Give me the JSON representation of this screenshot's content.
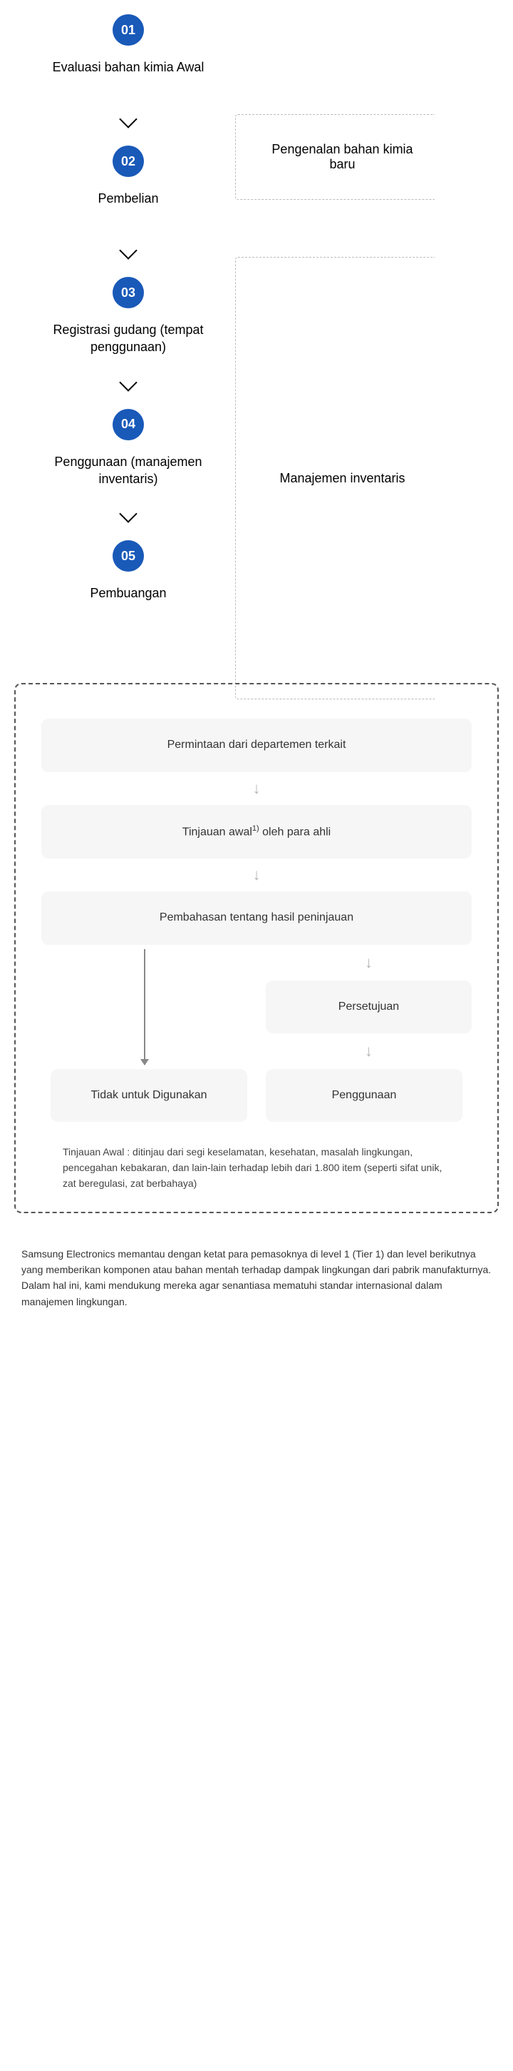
{
  "steps": [
    {
      "num": "01",
      "title": "Evaluasi bahan kimia Awal"
    },
    {
      "num": "02",
      "title": "Pembelian"
    },
    {
      "num": "03",
      "title": "Registrasi gudang (tempat penggunaan)"
    },
    {
      "num": "04",
      "title": "Penggunaan (manajemen inventaris)"
    },
    {
      "num": "05",
      "title": "Pembuangan"
    }
  ],
  "side": {
    "one": "Pengenalan bahan kimia baru",
    "two": "Manajemen inventaris"
  },
  "detail": {
    "c1": "Permintaan dari departemen terkait",
    "c2_pre": "Tinjauan awal",
    "c2_sup": "1)",
    "c2_post": " oleh para ahli",
    "c3": "Pembahasan tentang hasil peninjauan",
    "approve": "Persetujuan",
    "use": "Penggunaan",
    "reject": "Tidak untuk Digunakan"
  },
  "footnote": "Tinjauan Awal : ditinjau dari segi keselamatan, kesehatan, masalah lingkungan, pencegahan kebakaran, dan lain-lain terhadap lebih dari 1.800 item (seperti sifat unik, zat beregulasi, zat berbahaya)",
  "bottom": "Samsung Electronics memantau dengan ketat para pemasoknya di level 1 (Tier 1) dan level berikutnya yang memberikan komponen atau bahan mentah terhadap dampak lingkungan dari pabrik manufakturnya. Dalam hal ini, kami mendukung mereka agar senantiasa mematuhi standar internasional dalam manajemen lingkungan."
}
